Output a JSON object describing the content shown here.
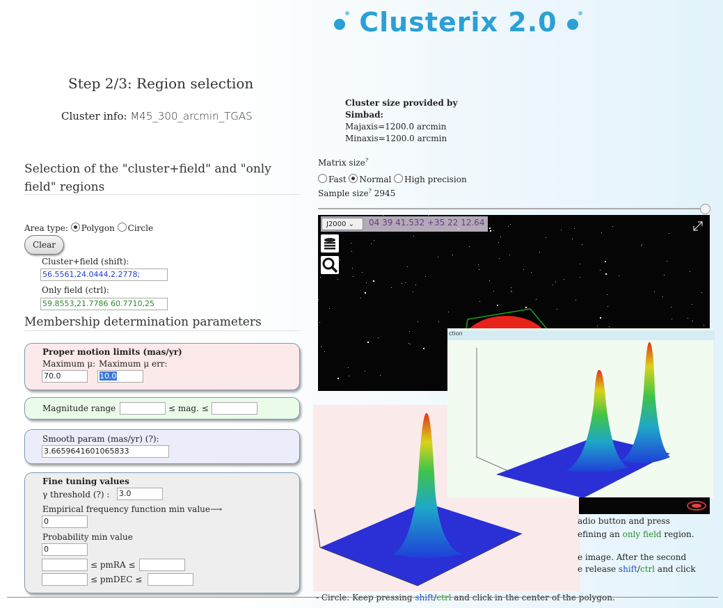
{
  "header": {
    "logo": "Clusterix 2.0",
    "step_title": "Step 2/3: Region selection"
  },
  "cluster_info": {
    "label": "Cluster info:",
    "name": "M45_300_arcmin_TGAS"
  },
  "simbad": {
    "title": "Cluster size provided by Simbad:",
    "majaxis": "Majaxis=1200.0 arcmin",
    "minaxis": "Minaxis=1200.0 arcmin"
  },
  "region_section": {
    "title_line1": "Selection of the \"cluster+field\" and \"only",
    "title_line2": "field\" regions",
    "area_type_label": "Area type:",
    "polygon_label": "Polygon",
    "circle_label": "Circle",
    "clear_label": "Clear",
    "cluster_field_label": "Cluster+field (shift):",
    "cluster_field_value": "56.5561,24.0444,2.2778;",
    "only_field_label": "Only field (ctrl):",
    "only_field_value": "59.8553,21.7786 60.7710,25"
  },
  "membership": {
    "title": "Membership determination parameters",
    "pm_title": "Proper motion limits (mas/yr)",
    "max_mu_label": "Maximum μ:",
    "max_mu_err_label": "Maximum μ err:",
    "max_mu_value": "70.0",
    "max_mu_err_value": "10.0",
    "mag_range_label": "Magnitude range",
    "mag_le_label": "≤ mag. ≤",
    "smooth_label": "Smooth param (mas/yr)  (?):",
    "smooth_value": "3.6659641601065833",
    "fine_title": "Fine tuning values",
    "gamma_label": "γ threshold (?) :",
    "gamma_value": "3.0",
    "emp_label": "Empirical frequency function min value⟶",
    "emp_value": "0",
    "prob_label": "Probability min value",
    "prob_value": "0",
    "pmra_label": "≤ pmRA ≤",
    "pmdec_label": "≤ pmDEC ≤"
  },
  "matrix": {
    "label": "Matrix size",
    "sup": "?",
    "fast": "Fast",
    "normal": "Normal",
    "high": "High precision",
    "sample_label": "Sample size",
    "sample_value": "2945"
  },
  "aladin": {
    "frame": "J2000",
    "coords": "04 39 41.532 +35 22 12.64"
  },
  "plot_front_title": "ction",
  "help": {
    "line1": "adio button and press",
    "line2a": "efining an ",
    "line2b": "only field",
    "line2c": " region.",
    "line3": "e image. After the second",
    "line4a": "e release ",
    "line4b": "shift",
    "line4c": "/",
    "line4d": "ctrl",
    "line4e": " and click",
    "line5a": "- Circle: Keep pressing ",
    "line5b": "shift",
    "line5c": "/",
    "line5d": "ctrl",
    "line5e": " and click in the center of the polygon."
  },
  "colors": {
    "accent": "#2aa0d6",
    "cluster_field": "#1a3fcf",
    "only_field": "#2a8a2a"
  }
}
